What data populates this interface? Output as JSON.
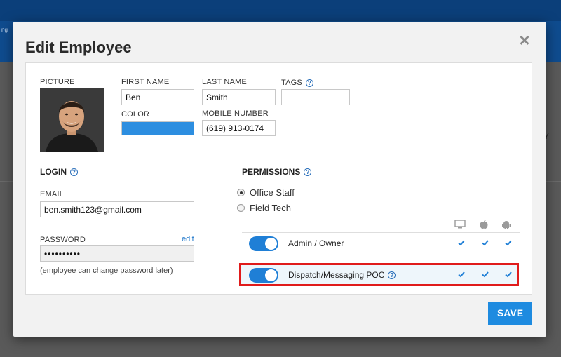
{
  "background": {
    "nav_text": "ng",
    "edge_digit": "7"
  },
  "modal": {
    "title": "Edit Employee",
    "close_label": "×"
  },
  "profile": {
    "picture_label": "PICTURE",
    "first_name_label": "FIRST NAME",
    "first_name": "Ben",
    "last_name_label": "LAST NAME",
    "last_name": "Smith",
    "tags_label": "TAGS",
    "tags_value": "",
    "color_label": "COLOR",
    "color_value": "#2d8ee0",
    "mobile_label": "MOBILE NUMBER",
    "mobile": "(619) 913-0174"
  },
  "login": {
    "heading": "LOGIN",
    "email_label": "EMAIL",
    "email": "ben.smith123@gmail.com",
    "password_label": "PASSWORD",
    "password_edit": "edit",
    "password": "••••••••••",
    "note": "(employee can change password later)"
  },
  "permissions": {
    "heading": "PERMISSIONS",
    "roles": [
      {
        "label": "Office Staff",
        "selected": true
      },
      {
        "label": "Field Tech",
        "selected": false
      }
    ],
    "columns": [
      "desktop-icon",
      "apple-icon",
      "android-icon"
    ],
    "rows": [
      {
        "label": "Admin / Owner",
        "enabled": true,
        "desktop": true,
        "ios": true,
        "android": true
      },
      {
        "label": "Dispatch/Messaging POC",
        "enabled": true,
        "desktop": true,
        "ios": true,
        "android": true,
        "highlighted": true
      }
    ]
  },
  "actions": {
    "save_label": "SAVE"
  },
  "colors": {
    "accent": "#1e8be0",
    "highlight_border": "#e01b1b",
    "link": "#1a74c9"
  }
}
